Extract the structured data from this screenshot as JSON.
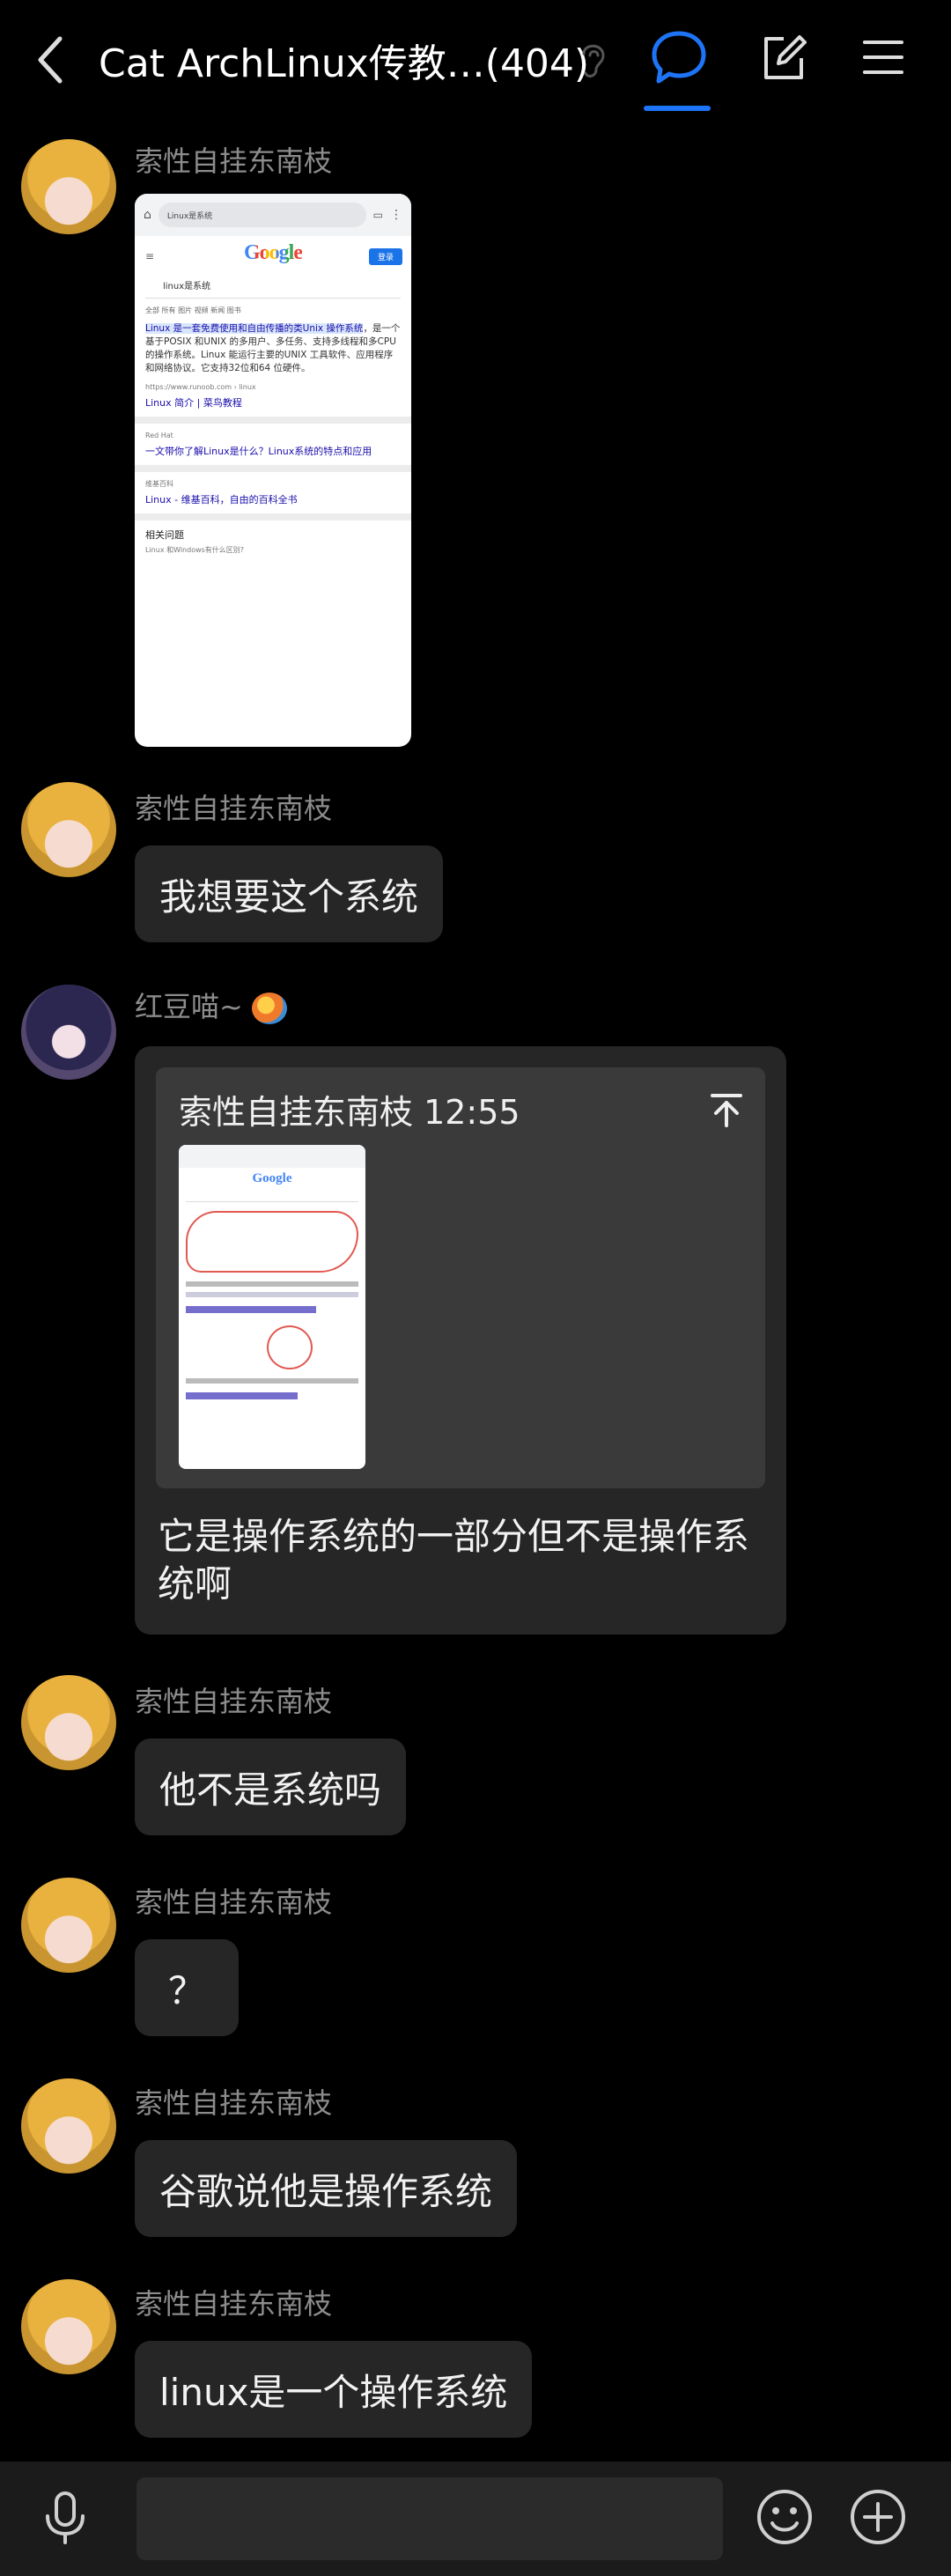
{
  "header": {
    "title": "Cat ArchLinux传教…(404)",
    "accent_color": "#1e74f6"
  },
  "icons": [
    "back-icon",
    "ear-icon",
    "chat-bubble-icon",
    "edit-icon",
    "menu-icon",
    "microphone-icon",
    "emoji-icon",
    "plus-icon",
    "pin-top-icon"
  ],
  "messages": [
    {
      "sender": "索性自挂东南枝",
      "type": "image",
      "screenshot": {
        "url_text": "Linux是系统",
        "logo": "Google",
        "button": "登录",
        "query": "linux是系统",
        "tabs": "全部   所有   图片   视频   新闻   图书",
        "snippet_highlight": "Linux 是一套免费使用和自由传播的类Unix 操作系统",
        "snippet_rest": "，是一个基于POSIX 和UNIX 的多用户、多任务、支持多线程和多CPU 的操作系统。Linux 能运行主要的UNIX 工具软件、应用程序和网络协议。它支持32位和64 位硬件。",
        "result1_site": "https://www.runoob.com › linux",
        "result1_title": "Linux 简介 | 菜鸟教程",
        "result2_site": "Red Hat",
        "result2_title": "一文带你了解Linux是什么？Linux系统的特点和应用",
        "result3_site": "维基百科",
        "result3_title": "Linux - 维基百科，自由的百科全书",
        "related": "相关问题",
        "related_q": "Linux 和Windows有什么区别?"
      }
    },
    {
      "sender": "索性自挂东南枝",
      "text": "我想要这个系统"
    },
    {
      "sender": "红豆喵~",
      "quote_header": "索性自挂东南枝 12:55",
      "text": "它是操作系统的一部分但不是操作系统啊"
    },
    {
      "sender": "索性自挂东南枝",
      "text": "他不是系统吗"
    },
    {
      "sender": "索性自挂东南枝",
      "text": "？"
    },
    {
      "sender": "索性自挂东南枝",
      "text": "谷歌说他是操作系统"
    },
    {
      "sender": "索性自挂东南枝",
      "text": "linux是一个操作系统"
    }
  ],
  "mini_shot": {
    "logo": "Google"
  }
}
